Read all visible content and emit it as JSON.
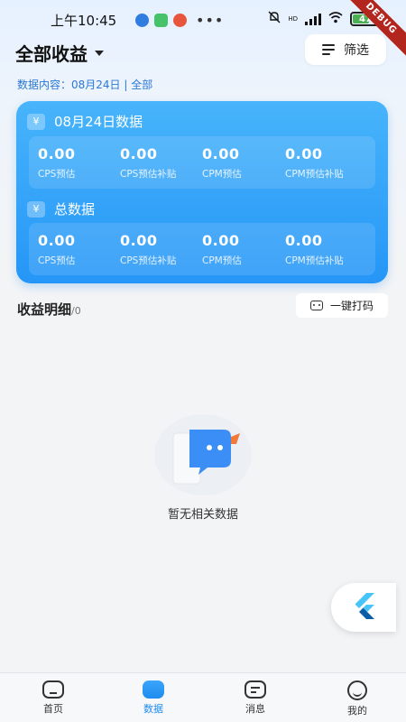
{
  "status_bar": {
    "time": "上午10:45",
    "network_label": "HD",
    "battery_level": "47",
    "debug_label": "DEBUG"
  },
  "header": {
    "title": "全部收益",
    "filter_label": "筛选"
  },
  "data_scope": "数据内容：08月24日 | 全部",
  "summary_card": {
    "currency_symbol": "¥",
    "sections": [
      {
        "title": "08月24日数据",
        "stats": [
          {
            "value": "0.00",
            "label": "CPS预估"
          },
          {
            "value": "0.00",
            "label": "CPS预估补贴"
          },
          {
            "value": "0.00",
            "label": "CPM预估"
          },
          {
            "value": "0.00",
            "label": "CPM预估补贴"
          }
        ]
      },
      {
        "title": "总数据",
        "stats": [
          {
            "value": "0.00",
            "label": "CPS预估"
          },
          {
            "value": "0.00",
            "label": "CPS预估补贴"
          },
          {
            "value": "0.00",
            "label": "CPM预估"
          },
          {
            "value": "0.00",
            "label": "CPM预估补贴"
          }
        ]
      }
    ]
  },
  "details": {
    "title": "收益明细",
    "count": "/0",
    "print_label": "一键打码"
  },
  "empty_state": {
    "message": "暂无相关数据"
  },
  "bottom_nav": {
    "items": [
      {
        "label": "首页",
        "icon": "home-icon"
      },
      {
        "label": "数据",
        "icon": "data-icon",
        "active": true
      },
      {
        "label": "消息",
        "icon": "message-icon"
      },
      {
        "label": "我的",
        "icon": "profile-icon"
      }
    ]
  },
  "colors": {
    "accent": "#1e8cf0",
    "card_top": "#47b4fb",
    "card_bottom": "#2596f7",
    "scope_text": "#2a78d6"
  }
}
